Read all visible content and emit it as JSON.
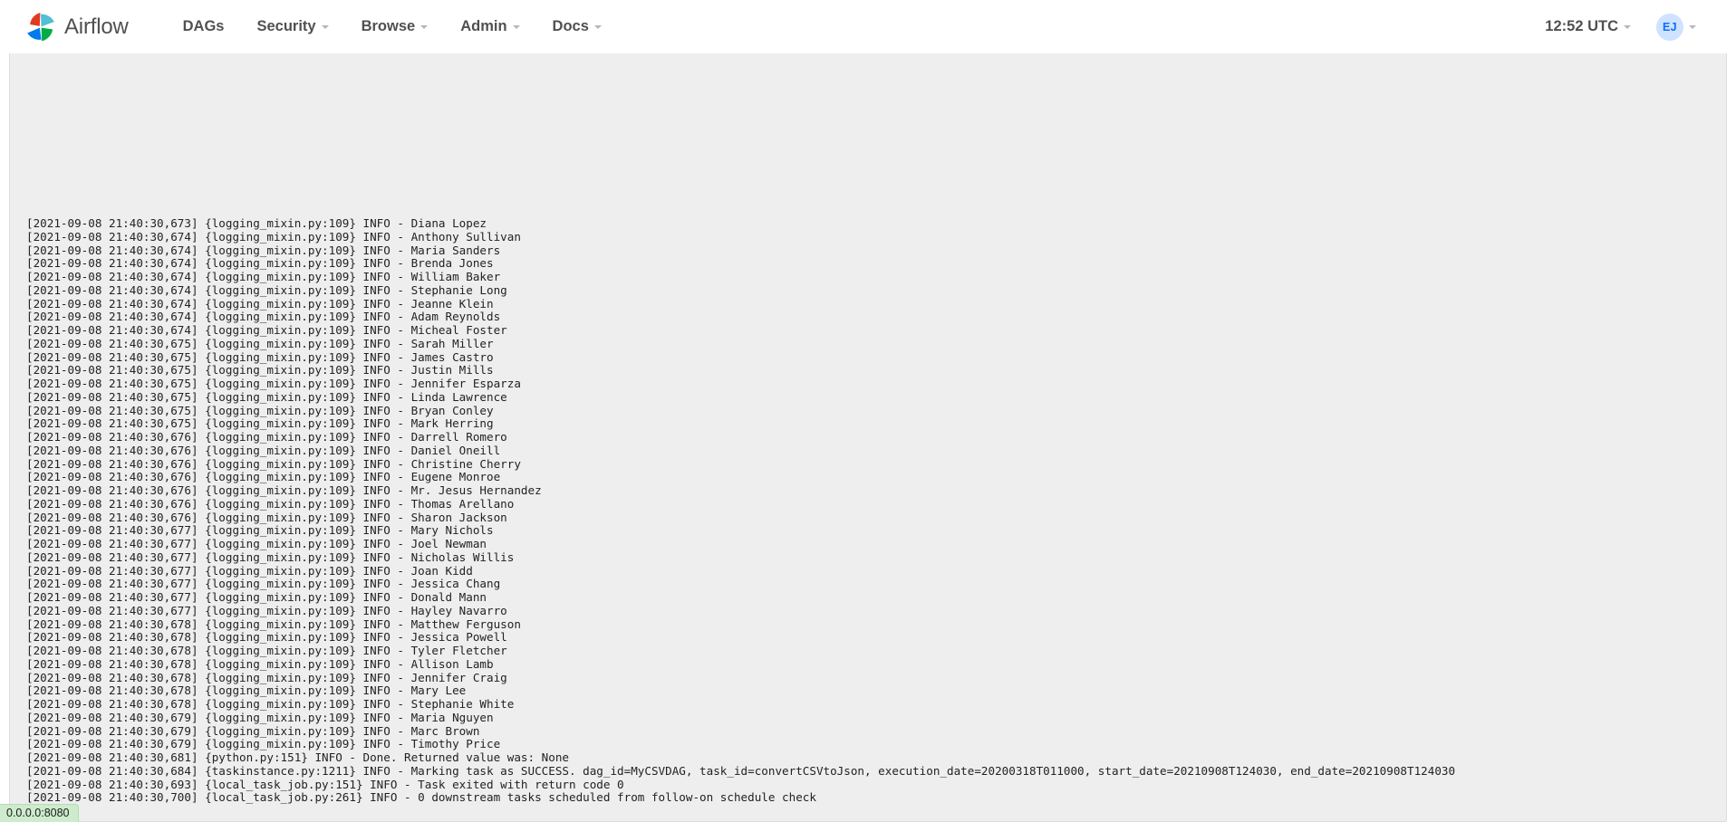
{
  "navbar": {
    "brand_name": "Airflow",
    "brand_logo_icon": "airflow-pinwheel-logo",
    "items": [
      {
        "label": "DAGs",
        "has_caret": false
      },
      {
        "label": "Security",
        "has_caret": true
      },
      {
        "label": "Browse",
        "has_caret": true
      },
      {
        "label": "Admin",
        "has_caret": true
      },
      {
        "label": "Docs",
        "has_caret": true
      }
    ],
    "time": "12:52 UTC",
    "time_caret_icon": "chevron-down-icon",
    "user_initials": "EJ",
    "user_caret_icon": "chevron-down-icon"
  },
  "status_bar": {
    "text": "0.0.0.0:8080"
  },
  "log": {
    "lines": [
      "[2021-09-08 21:40:30,673] {logging_mixin.py:109} INFO - Diana Lopez",
      "[2021-09-08 21:40:30,674] {logging_mixin.py:109} INFO - Anthony Sullivan",
      "[2021-09-08 21:40:30,674] {logging_mixin.py:109} INFO - Maria Sanders",
      "[2021-09-08 21:40:30,674] {logging_mixin.py:109} INFO - Brenda Jones",
      "[2021-09-08 21:40:30,674] {logging_mixin.py:109} INFO - William Baker",
      "[2021-09-08 21:40:30,674] {logging_mixin.py:109} INFO - Stephanie Long",
      "[2021-09-08 21:40:30,674] {logging_mixin.py:109} INFO - Jeanne Klein",
      "[2021-09-08 21:40:30,674] {logging_mixin.py:109} INFO - Adam Reynolds",
      "[2021-09-08 21:40:30,674] {logging_mixin.py:109} INFO - Micheal Foster",
      "[2021-09-08 21:40:30,675] {logging_mixin.py:109} INFO - Sarah Miller",
      "[2021-09-08 21:40:30,675] {logging_mixin.py:109} INFO - James Castro",
      "[2021-09-08 21:40:30,675] {logging_mixin.py:109} INFO - Justin Mills",
      "[2021-09-08 21:40:30,675] {logging_mixin.py:109} INFO - Jennifer Esparza",
      "[2021-09-08 21:40:30,675] {logging_mixin.py:109} INFO - Linda Lawrence",
      "[2021-09-08 21:40:30,675] {logging_mixin.py:109} INFO - Bryan Conley",
      "[2021-09-08 21:40:30,675] {logging_mixin.py:109} INFO - Mark Herring",
      "[2021-09-08 21:40:30,676] {logging_mixin.py:109} INFO - Darrell Romero",
      "[2021-09-08 21:40:30,676] {logging_mixin.py:109} INFO - Daniel Oneill",
      "[2021-09-08 21:40:30,676] {logging_mixin.py:109} INFO - Christine Cherry",
      "[2021-09-08 21:40:30,676] {logging_mixin.py:109} INFO - Eugene Monroe",
      "[2021-09-08 21:40:30,676] {logging_mixin.py:109} INFO - Mr. Jesus Hernandez",
      "[2021-09-08 21:40:30,676] {logging_mixin.py:109} INFO - Thomas Arellano",
      "[2021-09-08 21:40:30,676] {logging_mixin.py:109} INFO - Sharon Jackson",
      "[2021-09-08 21:40:30,677] {logging_mixin.py:109} INFO - Mary Nichols",
      "[2021-09-08 21:40:30,677] {logging_mixin.py:109} INFO - Joel Newman",
      "[2021-09-08 21:40:30,677] {logging_mixin.py:109} INFO - Nicholas Willis",
      "[2021-09-08 21:40:30,677] {logging_mixin.py:109} INFO - Joan Kidd",
      "[2021-09-08 21:40:30,677] {logging_mixin.py:109} INFO - Jessica Chang",
      "[2021-09-08 21:40:30,677] {logging_mixin.py:109} INFO - Donald Mann",
      "[2021-09-08 21:40:30,677] {logging_mixin.py:109} INFO - Hayley Navarro",
      "[2021-09-08 21:40:30,678] {logging_mixin.py:109} INFO - Matthew Ferguson",
      "[2021-09-08 21:40:30,678] {logging_mixin.py:109} INFO - Jessica Powell",
      "[2021-09-08 21:40:30,678] {logging_mixin.py:109} INFO - Tyler Fletcher",
      "[2021-09-08 21:40:30,678] {logging_mixin.py:109} INFO - Allison Lamb",
      "[2021-09-08 21:40:30,678] {logging_mixin.py:109} INFO - Jennifer Craig",
      "[2021-09-08 21:40:30,678] {logging_mixin.py:109} INFO - Mary Lee",
      "[2021-09-08 21:40:30,678] {logging_mixin.py:109} INFO - Stephanie White",
      "[2021-09-08 21:40:30,679] {logging_mixin.py:109} INFO - Maria Nguyen",
      "[2021-09-08 21:40:30,679] {logging_mixin.py:109} INFO - Marc Brown",
      "[2021-09-08 21:40:30,679] {logging_mixin.py:109} INFO - Timothy Price",
      "[2021-09-08 21:40:30,681] {python.py:151} INFO - Done. Returned value was: None",
      "[2021-09-08 21:40:30,684] {taskinstance.py:1211} INFO - Marking task as SUCCESS. dag_id=MyCSVDAG, task_id=convertCSVtoJson, execution_date=20200318T011000, start_date=20210908T124030, end_date=20210908T124030",
      "[2021-09-08 21:40:30,693] {local_task_job.py:151} INFO - Task exited with return code 0",
      "[2021-09-08 21:40:30,700] {local_task_job.py:261} INFO - 0 downstream tasks scheduled from follow-on schedule check"
    ]
  }
}
